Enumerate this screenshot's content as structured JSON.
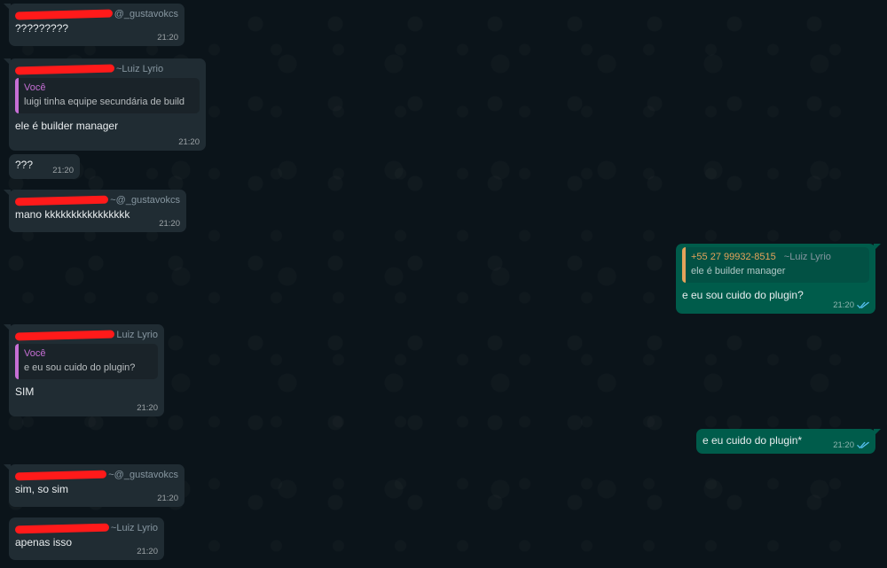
{
  "colors": {
    "background": "#0b141a",
    "incoming_bubble": "#202c33",
    "outgoing_bubble": "#005c4b",
    "redaction": "#ff1a1a",
    "quote_self_color": "#c66fd5",
    "quote_phone_color": "#e5a35b",
    "read_ticks": "#53bdeb"
  },
  "messages": [
    {
      "sender_suffix": "@_gustavokcs",
      "text": "?????????",
      "time": "21:20"
    },
    {
      "sender_suffix": "~Luiz Lyrio",
      "quote_name": "Você",
      "quote_text": "luigi tinha equipe secundária de build",
      "text": "ele é builder manager",
      "time": "21:20"
    },
    {
      "text": "???",
      "time": "21:20"
    },
    {
      "sender_suffix": "~@_gustavokcs",
      "text": "mano kkkkkkkkkkkkkkkk",
      "time": "21:20"
    },
    {
      "quote_phone": "+55 27 99932-8515",
      "quote_alias": "~Luiz Lyrio",
      "quote_text": "ele é builder manager",
      "text": "e eu sou cuido do plugin?",
      "time": "21:20"
    },
    {
      "sender_suffix": "Luiz Lyrio",
      "quote_name": "Você",
      "quote_text": "e eu sou cuido do plugin?",
      "text": "SIM",
      "time": "21:20"
    },
    {
      "text": "e eu cuido do plugin*",
      "time": "21:20"
    },
    {
      "sender_suffix": "~@_gustavokcs",
      "text": "sim, so sim",
      "time": "21:20"
    },
    {
      "sender_suffix": "~Luiz Lyrio",
      "text": "apenas isso",
      "time": "21:20"
    }
  ]
}
